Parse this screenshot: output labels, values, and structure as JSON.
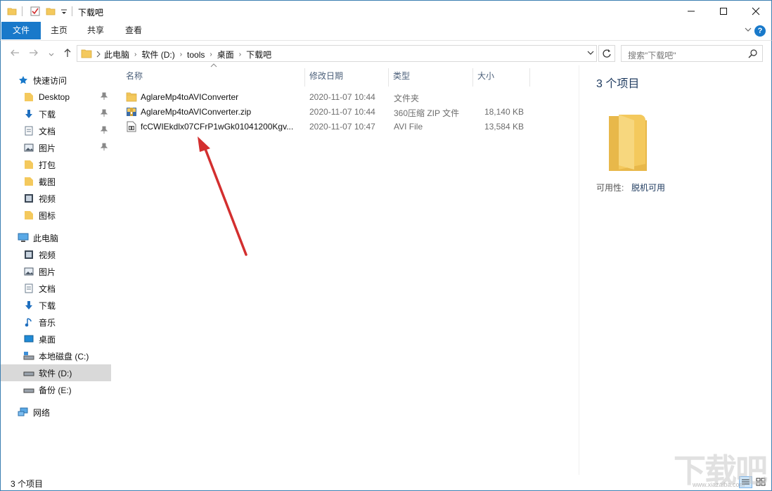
{
  "window": {
    "title": "下载吧",
    "controls": {
      "minimize": "—",
      "maximize": "☐",
      "close": "✕"
    }
  },
  "ribbon": {
    "tabs": [
      "文件",
      "主页",
      "共享",
      "查看"
    ],
    "expand_icon": "chevron-down-icon",
    "help": "?"
  },
  "address": {
    "path": [
      "此电脑",
      "软件 (D:)",
      "tools",
      "桌面",
      "下载吧"
    ],
    "search_placeholder": "搜索\"下载吧\""
  },
  "navigation": {
    "quick_access": {
      "label": "快速访问",
      "items": [
        {
          "label": "Desktop",
          "icon": "folder-icon",
          "pinned": true
        },
        {
          "label": "下载",
          "icon": "download-icon",
          "pinned": true
        },
        {
          "label": "文档",
          "icon": "document-icon",
          "pinned": true
        },
        {
          "label": "图片",
          "icon": "picture-icon",
          "pinned": true
        },
        {
          "label": "打包",
          "icon": "folder-icon",
          "pinned": false
        },
        {
          "label": "截图",
          "icon": "folder-icon",
          "pinned": false
        },
        {
          "label": "视频",
          "icon": "video-icon",
          "pinned": false
        },
        {
          "label": "图标",
          "icon": "folder-icon",
          "pinned": false
        }
      ]
    },
    "this_pc": {
      "label": "此电脑",
      "items": [
        {
          "label": "视频",
          "icon": "video-icon"
        },
        {
          "label": "图片",
          "icon": "picture-icon"
        },
        {
          "label": "文档",
          "icon": "document-icon"
        },
        {
          "label": "下载",
          "icon": "download-icon"
        },
        {
          "label": "音乐",
          "icon": "music-icon"
        },
        {
          "label": "桌面",
          "icon": "desktop-icon"
        },
        {
          "label": "本地磁盘 (C:)",
          "icon": "drive-c-icon"
        },
        {
          "label": "软件 (D:)",
          "icon": "drive-icon",
          "selected": true
        },
        {
          "label": "备份 (E:)",
          "icon": "drive-icon"
        }
      ]
    },
    "network": {
      "label": "网络"
    }
  },
  "file_list": {
    "columns": [
      "名称",
      "修改日期",
      "类型",
      "大小"
    ],
    "rows": [
      {
        "name": "AglareMp4toAVIConverter",
        "date": "2020-11-07 10:44",
        "type": "文件夹",
        "size": "",
        "icon": "folder-icon"
      },
      {
        "name": "AglareMp4toAVIConverter.zip",
        "date": "2020-11-07 10:44",
        "type": "360压缩 ZIP 文件",
        "size": "18,140 KB",
        "icon": "zip-archive-icon"
      },
      {
        "name": "fcCWIEkdlx07CFrP1wGk01041200Kgv...",
        "date": "2020-11-07 10:47",
        "type": "AVI File",
        "size": "13,584 KB",
        "icon": "avi-file-icon"
      }
    ]
  },
  "details": {
    "count": "3 个项目",
    "availability_label": "可用性:",
    "availability_value": "脱机可用"
  },
  "status": {
    "text": "3 个项目"
  },
  "watermark": {
    "text": "下载吧",
    "url": "www.xiazaiba.com"
  },
  "colors": {
    "accent": "#1979ca",
    "folder": "#f4c95d",
    "arrow": "#d32f2f",
    "selection": "#d9d9d9",
    "window_border": "#3c7fb1"
  }
}
